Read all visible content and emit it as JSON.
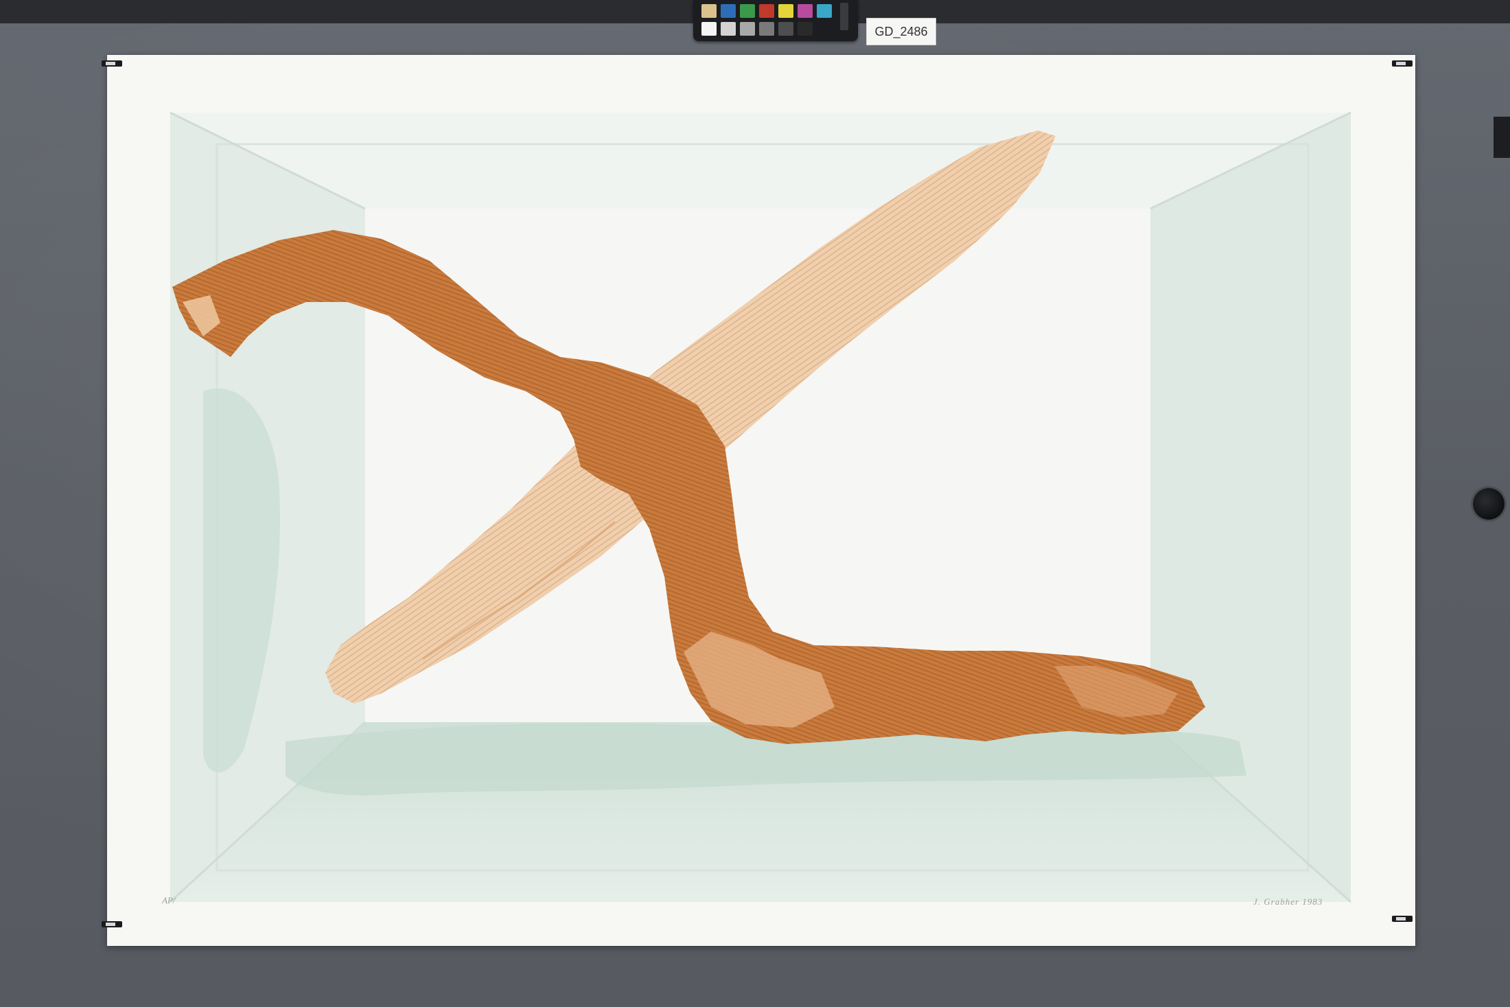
{
  "scan": {
    "label": "GD_2486"
  },
  "color_checker": {
    "patches_top": [
      "#d9c28c",
      "#2d6db8",
      "#3a9a4a",
      "#c0392b",
      "#e3d43c",
      "#b84b9e",
      "#3aa6c8"
    ],
    "patches_bottom": [
      "#f4f4f4",
      "#d3d3d3",
      "#a8a8a8",
      "#7a7a7a",
      "#4e4e4e",
      "#2a2a2a"
    ]
  },
  "print": {
    "edition_text": "AP/",
    "signature_text": "J. Grabher 1983",
    "colors": {
      "paper": "#f7f7f4",
      "box_tint": "#e4ece7",
      "box_shade": "#cfe0d8",
      "branch_dark": "#c7773a",
      "branch_light": "#ecc7a3"
    }
  }
}
